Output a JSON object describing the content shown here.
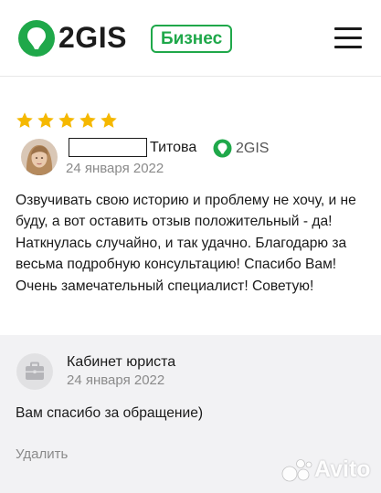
{
  "header": {
    "logo_text": "2GIS",
    "badge": "Бизнес",
    "brand_color": "#1fa84a",
    "icons": [
      "2gis-pin-icon",
      "hamburger-menu-icon"
    ]
  },
  "review": {
    "rating": 5,
    "rating_max": 5,
    "star_color": "#f5b800",
    "author_name_visible": "Титова",
    "source_label": "2GIS",
    "date": "24 января 2022",
    "text": "Озвучивать свою историю и проблему не хочу, и не буду, а вот оставить отзыв положительный - да! Наткнулась случайно, и так удачно. Благодарю за весьма подробную консультацию! Спасибо Вам! Очень замечательный специалист! Советую!"
  },
  "reply": {
    "author": "Кабинет юриста",
    "date": "24 января 2022",
    "text": "Вам спасибо за обращение)",
    "delete_label": "Удалить",
    "icon": "briefcase-icon"
  },
  "watermark": {
    "text": "Avito"
  }
}
